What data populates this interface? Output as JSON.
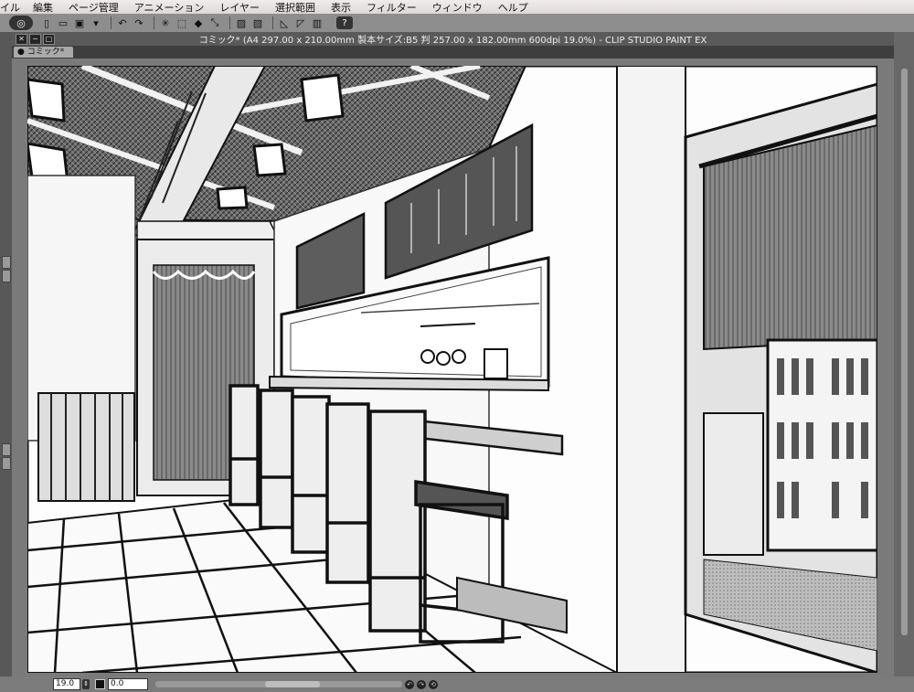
{
  "menubar": {
    "items": [
      "イル",
      "編集",
      "ページ管理",
      "アニメーション",
      "レイヤー",
      "選択範囲",
      "表示",
      "フィルター",
      "ウィンドウ",
      "ヘルプ"
    ]
  },
  "toolbar": {
    "help_label": "?"
  },
  "window": {
    "title": "コミック* (A4 297.00 x 210.00mm 製本サイズ:B5 判 257.00 x 182.00mm 600dpi 19.0%) - CLIP STUDIO PAINT EX",
    "tab_label": "コミック*"
  },
  "status": {
    "zoom": "19.0",
    "rotation": "0.0"
  }
}
